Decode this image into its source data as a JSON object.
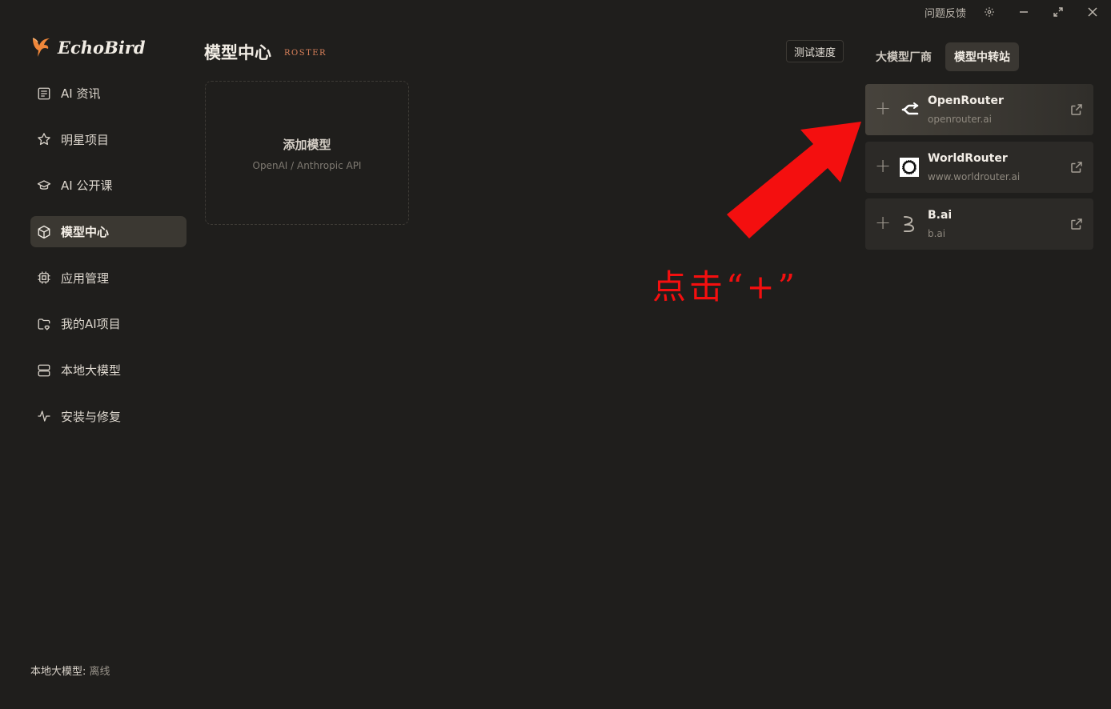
{
  "titlebar": {
    "feedback_label": "问题反馈",
    "icons": [
      "settings-icon",
      "minimize-icon",
      "maximize-icon",
      "close-icon"
    ]
  },
  "brand": {
    "name": "EchoBird",
    "logo_icon": "bird-icon",
    "accent": "#f0873a"
  },
  "sidebar": {
    "items": [
      {
        "label": "AI 资讯",
        "icon": "news-icon"
      },
      {
        "label": "明星项目",
        "icon": "star-icon"
      },
      {
        "label": "AI 公开课",
        "icon": "graduation-cap-icon"
      },
      {
        "label": "模型中心",
        "icon": "cube-icon",
        "active": true
      },
      {
        "label": "应用管理",
        "icon": "chip-icon"
      },
      {
        "label": "我的AI项目",
        "icon": "folder-heart-icon"
      },
      {
        "label": "本地大模型",
        "icon": "server-icon"
      },
      {
        "label": "安装与修复",
        "icon": "activity-icon"
      }
    ],
    "status_label": "本地大模型:",
    "status_value": "离线"
  },
  "main": {
    "title": "模型中心",
    "subtitle": "ROSTER",
    "speed_button": "测试速度",
    "add_card": {
      "title": "添加模型",
      "subtitle": "OpenAI / Anthropic API"
    }
  },
  "right_panel": {
    "tabs": [
      {
        "label": "大模型厂商",
        "active": false
      },
      {
        "label": "模型中转站",
        "active": true
      }
    ],
    "providers": [
      {
        "name": "OpenRouter",
        "url": "openrouter.ai",
        "logo": "openrouter-logo-icon"
      },
      {
        "name": "WorldRouter",
        "url": "www.worldrouter.ai",
        "logo": "worldrouter-logo-icon"
      },
      {
        "name": "B.ai",
        "url": "b.ai",
        "logo": "bai-logo-icon"
      }
    ]
  },
  "annotation": {
    "text": "点击“+”",
    "color": "#f40f0f"
  }
}
